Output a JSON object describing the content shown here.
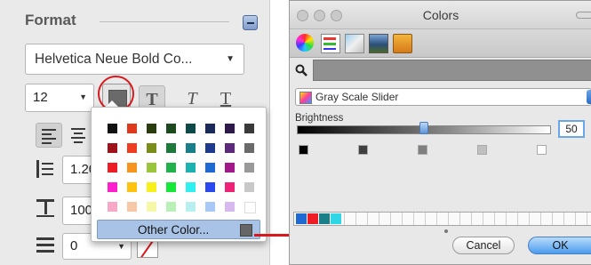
{
  "format_panel": {
    "title": "Format",
    "font_name": "Helvetica Neue Bold Co...",
    "font_size": "12",
    "line_spacing": "1.20",
    "indent": "100",
    "list_level": "0",
    "current_color": "#6a6a6a"
  },
  "color_popup": {
    "swatches": [
      [
        "#111111",
        "#e03a1e",
        "#2b3d0e",
        "#1c4a1e",
        "#0e4a4a",
        "#1a2a5a",
        "#2e1a4a",
        "#3a3a3a"
      ],
      [
        "#a0121a",
        "#ef3d22",
        "#7a8d1a",
        "#1d7a3a",
        "#19808a",
        "#1e3a8c",
        "#5b2a7a",
        "#6a6a6a"
      ],
      [
        "#ee1c24",
        "#f7941d",
        "#9ac43c",
        "#22b24c",
        "#1cb2b0",
        "#1e6ad2",
        "#a21a8a",
        "#999999"
      ],
      [
        "#ff1fcc",
        "#ffc20e",
        "#f7f01a",
        "#16e83a",
        "#2ef0f0",
        "#2a4af0",
        "#ee2277",
        "#c8c8c8"
      ],
      [
        "#f7a8c8",
        "#f7c8a8",
        "#f7f7a8",
        "#b8f0b8",
        "#b8f0f0",
        "#a8c8f7",
        "#d8b8f0",
        "#ffffff"
      ]
    ],
    "other_label": "Other Color..."
  },
  "colors_window": {
    "title": "Colors",
    "mode_label": "Gray Scale Slider",
    "slider_label": "Brightness",
    "slider_value": "50",
    "slider_fraction": 0.5,
    "gray_swatches": [
      "#000000",
      "#3f3f3f",
      "#7f7f7f",
      "#bfbfbf",
      "#ffffff"
    ],
    "saved_swatches": [
      "#1e6ad2",
      "#ee1c24",
      "#19808a",
      "#2ed6e6"
    ],
    "cancel_label": "Cancel",
    "ok_label": "OK"
  }
}
